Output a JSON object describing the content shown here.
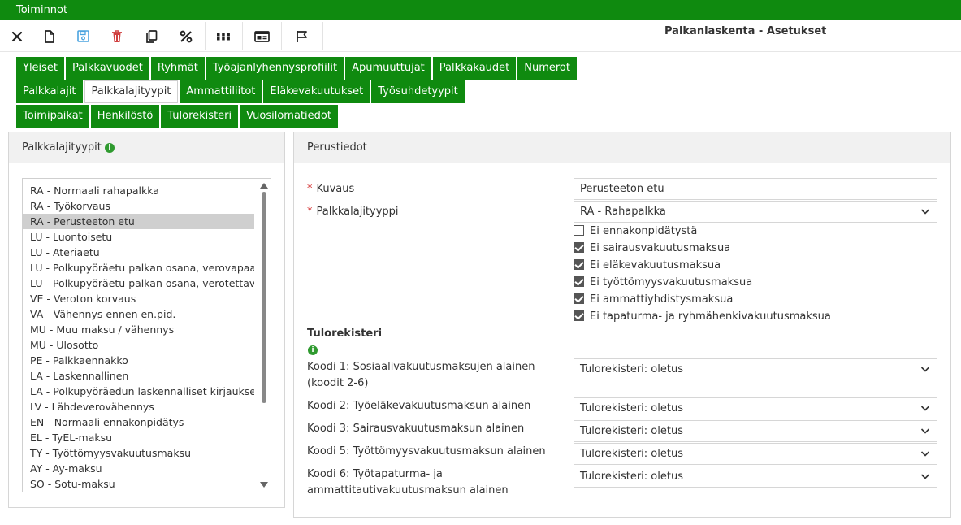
{
  "topbar": {
    "title": "Toiminnot"
  },
  "toolbar": {
    "buttons": [
      "close-icon",
      "new-document-icon",
      "save-icon",
      "delete-icon",
      "copy-icon",
      "percent-icon",
      "grid-icon",
      "id-card-icon",
      "flag-icon"
    ]
  },
  "app_title": "Palkanlaskenta - Asetukset",
  "tabs": {
    "row1": [
      "Yleiset",
      "Palkkavuodet",
      "Ryhmät",
      "Työajanlyhennysprofiilit",
      "Apumuuttujat",
      "Palkkakaudet",
      "Numerot"
    ],
    "row2": [
      "Palkkalajit",
      "Palkkalajityypit",
      "Ammattiliitot",
      "Eläkevakuutukset",
      "Työsuhdetyypit"
    ],
    "row3": [
      "Toimipaikat",
      "Henkilöstö",
      "Tulorekisteri",
      "Vuosilomatiedot"
    ],
    "active": "Palkkalajityypit"
  },
  "left_panel": {
    "title": "Palkkalajityypit",
    "items": [
      "RA - Normaali rahapalkka",
      "RA - Työkorvaus",
      "RA - Perusteeton etu",
      "LU - Luontoisetu",
      "LU - Ateriaetu",
      "LU - Polkupyöräetu palkan osana, verovapaa os",
      "LU - Polkupyöräetu palkan osana, verotettavan",
      "VE - Veroton korvaus",
      "VA - Vähennys ennen en.pid.",
      "MU - Muu maksu / vähennys",
      "MU - Ulosotto",
      "PE - Palkkaennakko",
      "LA - Laskennallinen",
      "LA - Polkupyöräedun laskennalliset kirjaukset",
      "LV - Lähdeverovähennys",
      "EN - Normaali ennakonpidätys",
      "EL - TyEL-maksu",
      "TY - Työttömyysvakuutusmaksu",
      "AY - Ay-maksu",
      "SO - Sotu-maksu"
    ],
    "selected_index": 2
  },
  "right_panel": {
    "title": "Perustiedot",
    "kuvaus_label": "Kuvaus",
    "kuvaus_value": "Perusteeton etu",
    "tyyppi_label": "Palkkalajityyppi",
    "tyyppi_value": "RA - Rahapalkka",
    "checkboxes": [
      {
        "label": "Ei ennakonpidätystä",
        "checked": false
      },
      {
        "label": "Ei sairausvakuutusmaksua",
        "checked": true
      },
      {
        "label": "Ei eläkevakuutusmaksua",
        "checked": true
      },
      {
        "label": "Ei työttömyysvakuutusmaksua",
        "checked": true
      },
      {
        "label": "Ei ammattiyhdistysmaksua",
        "checked": true
      },
      {
        "label": "Ei tapaturma- ja ryhmähenkivakuutusmaksua",
        "checked": true
      }
    ],
    "tulorekisteri_title": "Tulorekisteri",
    "codes": [
      {
        "label": "Koodi 1: Sosiaalivakuutusmaksujen alainen (koodit 2-6)",
        "value": "Tulorekisteri: oletus"
      },
      {
        "label": "Koodi 2: Työeläkevakuutusmaksun alainen",
        "value": "Tulorekisteri: oletus"
      },
      {
        "label": "Koodi 3: Sairausvakuutusmaksun alainen",
        "value": "Tulorekisteri: oletus"
      },
      {
        "label": "Koodi 5: Työttömyysvakuutusmaksun alainen",
        "value": "Tulorekisteri: oletus"
      },
      {
        "label": "Koodi 6: Työtapaturma- ja ammattitautivakuutusmaksun alainen",
        "value": "Tulorekisteri: oletus"
      }
    ]
  },
  "colors": {
    "brand_green": "#0f8a0f",
    "delete_red": "#d04040",
    "save_blue": "#4aa3df"
  }
}
